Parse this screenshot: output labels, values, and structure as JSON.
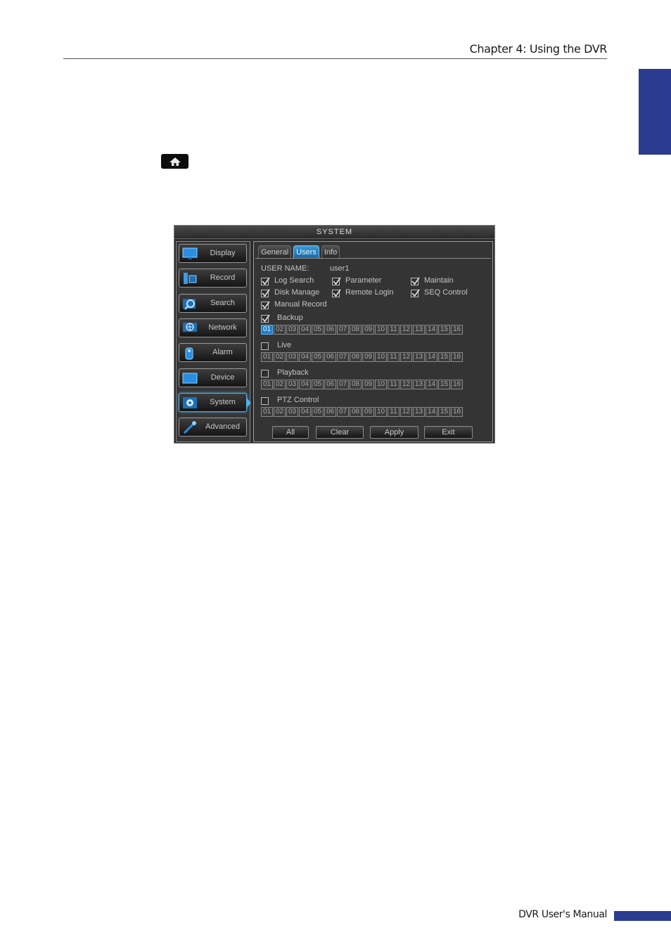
{
  "header": {
    "chapter": "Chapter 4: Using the DVR"
  },
  "footer": {
    "manual": "DVR User's Manual"
  },
  "icons": {
    "home": "home-icon"
  },
  "colors": {
    "accent_blue": "#2b3b8f",
    "dvr_highlight": "#1f7fc9"
  },
  "dvr": {
    "title": "SYSTEM",
    "nav": [
      {
        "label": "Display",
        "icon": "monitor-icon"
      },
      {
        "label": "Record",
        "icon": "record-icon"
      },
      {
        "label": "Search",
        "icon": "magnifier-icon"
      },
      {
        "label": "Network",
        "icon": "globe-icon"
      },
      {
        "label": "Alarm",
        "icon": "alarm-icon"
      },
      {
        "label": "Device",
        "icon": "device-icon"
      },
      {
        "label": "System",
        "icon": "gear-icon",
        "active": true
      },
      {
        "label": "Advanced",
        "icon": "wrench-icon"
      }
    ],
    "tabs": [
      {
        "label": "General"
      },
      {
        "label": "Users",
        "active": true
      },
      {
        "label": "Info"
      }
    ],
    "user_name_label": "USER NAME:",
    "user_name_value": "user1",
    "permissions": [
      {
        "label": "Log Search",
        "checked": true
      },
      {
        "label": "Parameter",
        "checked": true
      },
      {
        "label": "Maintain",
        "checked": true
      },
      {
        "label": "Disk Manage",
        "checked": true
      },
      {
        "label": "Remote Login",
        "checked": true
      },
      {
        "label": "SEQ Control",
        "checked": true
      },
      {
        "label": "Manual Record",
        "checked": true
      }
    ],
    "channel_groups": [
      {
        "label": "Backup",
        "checked": true,
        "selected": [
          "01"
        ]
      },
      {
        "label": "Live",
        "checked": false,
        "selected": []
      },
      {
        "label": "Playback",
        "checked": false,
        "selected": []
      },
      {
        "label": "PTZ Control",
        "checked": false,
        "selected": []
      }
    ],
    "channels": [
      "01",
      "02",
      "03",
      "04",
      "05",
      "06",
      "07",
      "08",
      "09",
      "10",
      "11",
      "12",
      "13",
      "14",
      "15",
      "16"
    ],
    "buttons": {
      "all": "All",
      "clear": "Clear",
      "apply": "Apply",
      "exit": "Exit"
    }
  }
}
